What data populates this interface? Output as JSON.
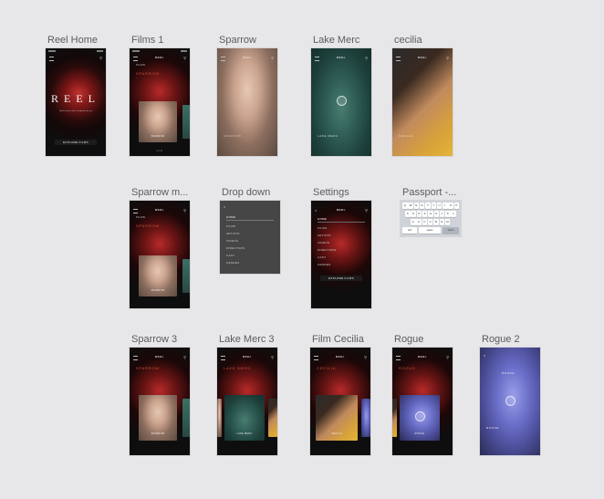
{
  "artboards": {
    "reel_home": {
      "label": "Reel Home",
      "logo": "REEL",
      "hero": "REEL",
      "tagline": "Watch the best films, handpicked for you",
      "cta": "EXPLORE FILMS"
    },
    "films_1": {
      "label": "Films 1",
      "logo": "REEL",
      "section": "FILMS",
      "title": "SPARROW",
      "caption": "SPARROW",
      "dots": "1/3"
    },
    "sparrow": {
      "label": "Sparrow",
      "logo": "REEL",
      "title": "SPARROW"
    },
    "lake_merc": {
      "label": "Lake Merc",
      "logo": "REEL",
      "title": "LAKE MERC"
    },
    "cecilia": {
      "label": "cecilia",
      "logo": "REEL",
      "title": "CECILIA"
    },
    "sparrow_m": {
      "label": "Sparrow m...",
      "logo": "REEL",
      "section": "FILMS",
      "title": "SPARROW",
      "caption": "SPARROW"
    },
    "drop_down": {
      "label": "Drop down",
      "items": [
        "HOME",
        "FILMS",
        "ARTISTS",
        "VIDEOS",
        "DIRECTORS",
        "CAST",
        "GENRES"
      ]
    },
    "settings": {
      "label": "Settings",
      "logo": "REEL",
      "items": [
        "HOME",
        "FILMS",
        "ARTISTS",
        "VIDEOS",
        "DIRECTORS",
        "CAST",
        "GENRES"
      ],
      "cta": "EXPLORE FILMS"
    },
    "passport": {
      "label": "Passport -...",
      "row1": [
        "Q",
        "W",
        "E",
        "R",
        "T",
        "Y",
        "U",
        "I",
        "O",
        "P"
      ],
      "row2": [
        "A",
        "S",
        "D",
        "F",
        "G",
        "H",
        "J",
        "K",
        "L"
      ],
      "row3": [
        "Z",
        "X",
        "C",
        "V",
        "B",
        "N",
        "M"
      ],
      "space": "space",
      "return": "return"
    },
    "sparrow_3": {
      "label": "Sparrow 3",
      "logo": "REEL",
      "title": "SPARROW",
      "caption": "SPARROW"
    },
    "lake_merc_3": {
      "label": "Lake Merc 3",
      "logo": "REEL",
      "title": "LAKE MERC",
      "caption": "LAKE MERC"
    },
    "film_cecilia": {
      "label": "Film Cecilia",
      "logo": "REEL",
      "title": "CECILIA",
      "caption": "CECILIA"
    },
    "rogue": {
      "label": "Rogue",
      "logo": "REEL",
      "title": "ROGUE",
      "caption": "ROGUE"
    },
    "rogue_2": {
      "label": "Rogue 2",
      "title": "ROGUE",
      "overlay": "ROGUE"
    }
  },
  "icons": {
    "menu": "hamburger-icon",
    "search": "search-icon",
    "close": "close-icon",
    "play": "play-icon"
  },
  "colors": {
    "canvas": "#e7e7ea",
    "accent": "#c8553a",
    "frame_dark": "#141414"
  }
}
